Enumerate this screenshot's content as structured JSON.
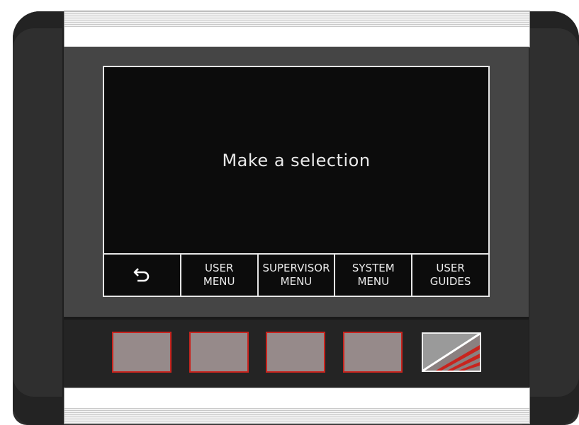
{
  "screen": {
    "prompt": "Make a selection"
  },
  "softkeys": [
    {
      "icon": "back-arrow-icon",
      "line1": "⮌"
    },
    {
      "line1": "USER",
      "line2": "MENU"
    },
    {
      "line1": "SUPERVISOR",
      "line2": "MENU"
    },
    {
      "line1": "SYSTEM",
      "line2": "MENU"
    },
    {
      "line1": "USER",
      "line2": "GUIDES"
    }
  ],
  "hardware": {
    "button_count": 4,
    "button_color": "#968a8a",
    "button_border_color": "#c8241e",
    "logo_icon": "brand-logo-icon"
  },
  "colors": {
    "screen_bg": "#0c0c0c",
    "bezel": "#454545",
    "text": "#e9e9e9"
  }
}
